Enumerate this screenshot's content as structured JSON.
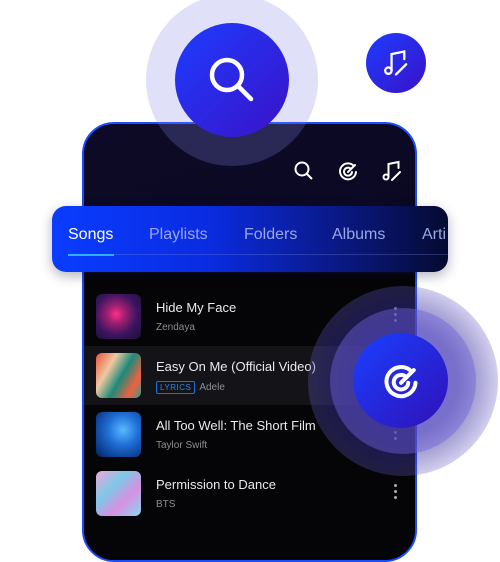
{
  "header": {
    "icons": [
      "search-icon",
      "song-recognition-icon",
      "music-edit-icon"
    ]
  },
  "tabs": [
    {
      "label": "Songs",
      "active": true
    },
    {
      "label": "Playlists"
    },
    {
      "label": "Folders"
    },
    {
      "label": "Albums"
    },
    {
      "label": "Arti"
    }
  ],
  "songs": [
    {
      "title": "Hide My Face",
      "artist": "Zendaya"
    },
    {
      "title": "Easy On Me (Official Video)",
      "artist": "Adele",
      "badge": "LYRICS",
      "highlighted": true
    },
    {
      "title": "All Too Well: The Short Film",
      "artist": "Taylor Swift"
    },
    {
      "title": "Permission to Dance",
      "artist": "BTS"
    }
  ],
  "colors": {
    "accent": "#1a4dff",
    "badge": "#2f86f0"
  }
}
